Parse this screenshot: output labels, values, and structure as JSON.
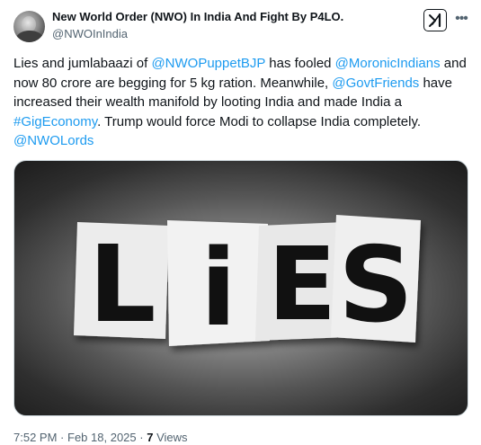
{
  "author": {
    "name": "New World Order (NWO) In India And Fight By P4LO.",
    "handle": "@NWOInIndia"
  },
  "post": {
    "segments": [
      {
        "text": "Lies and jumlabaazi of ",
        "link": false
      },
      {
        "text": "@NWOPuppetBJP",
        "link": true
      },
      {
        "text": " has fooled ",
        "link": false
      },
      {
        "text": "@MoronicIndians",
        "link": true
      },
      {
        "text": " and now 80 crore are begging for 5 kg ration. Meanwhile, ",
        "link": false
      },
      {
        "text": "@GovtFriends",
        "link": true
      },
      {
        "text": " have increased their wealth manifold by looting India and made India a ",
        "link": false
      },
      {
        "text": "#GigEconomy",
        "link": true
      },
      {
        "text": ". Trump would force Modi to collapse India completely. ",
        "link": false
      },
      {
        "text": "@NWOLords",
        "link": true
      }
    ],
    "image_letters": [
      "L",
      "i",
      "E",
      "S"
    ]
  },
  "meta": {
    "time": "7:52 PM",
    "separator": "·",
    "date": "Feb 18, 2025",
    "views_count": "7",
    "views_label": "Views"
  },
  "icons": {
    "grok": "grok-icon",
    "more": "more-horizontal-icon"
  },
  "colors": {
    "link": "#1d9bf0",
    "text": "#0f1419",
    "secondary": "#536471"
  }
}
